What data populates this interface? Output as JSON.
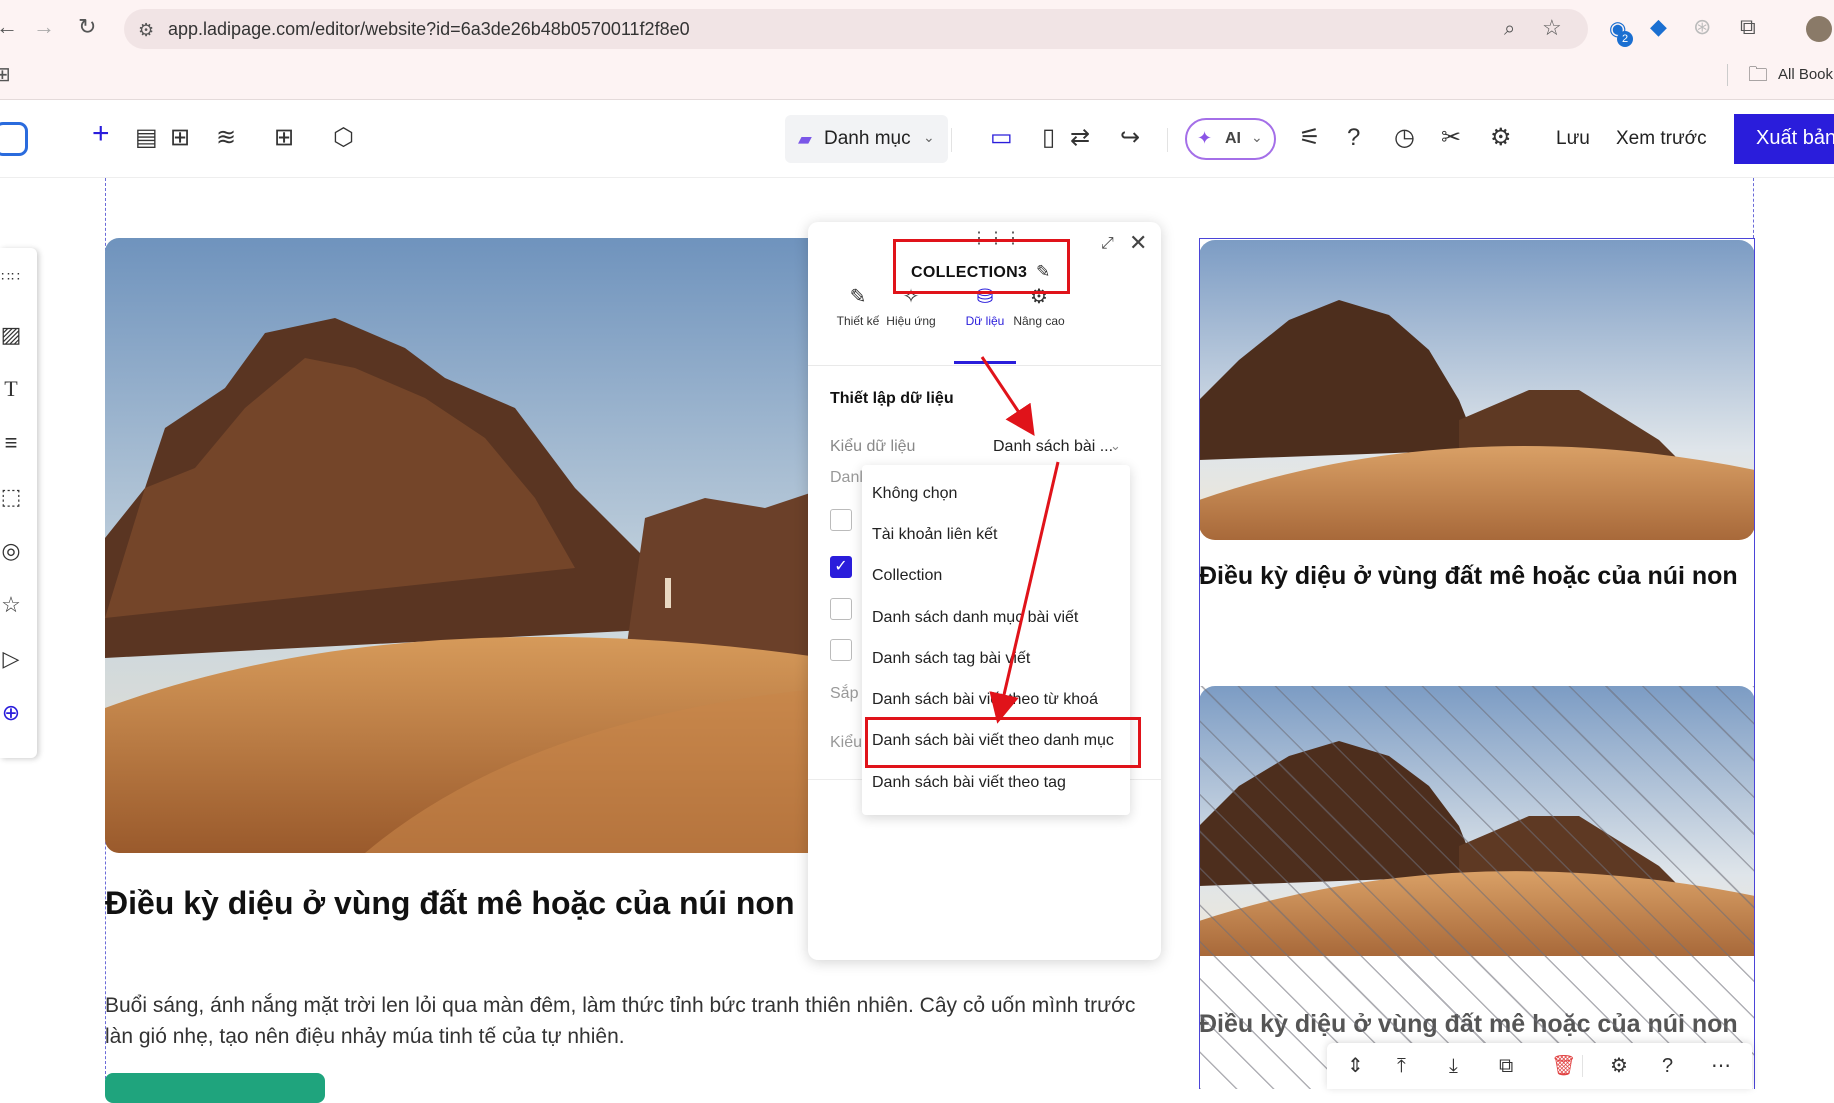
{
  "browser": {
    "url": "app.ladipage.com/editor/website?id=6a3de26b48b0570011f2f8e0",
    "bookmarks_label": "All Book",
    "ext_badge": "2"
  },
  "toolbar": {
    "category_label": "Danh mục",
    "ai_label": "AI",
    "save_label": "Lưu",
    "preview_label": "Xem trước",
    "publish_label": "Xuất bản"
  },
  "canvas": {
    "main_title": "Điều kỳ diệu ở vùng đất mê hoặc của núi non",
    "main_desc": "Buổi sáng, ánh nắng mặt trời len lỏi qua màn đêm, làm thức tỉnh bức tranh thiên nhiên. Cây cỏ uốn mình trước làn gió nhẹ, tạo nên điệu nhảy múa tinh tế của tự nhiên.",
    "card1_title": "Điều kỳ diệu ở vùng đất mê hoặc của núi non",
    "card2_title": "Điều kỳ diệu ở vùng đất mê hoặc của núi non"
  },
  "panel": {
    "title": "COLLECTION3",
    "tabs": [
      {
        "label": "Thiết kế",
        "icon": "edit-icon"
      },
      {
        "label": "Hiệu ứng",
        "icon": "magic-wand-icon"
      },
      {
        "label": "Dữ liệu",
        "icon": "database-icon"
      },
      {
        "label": "Nâng cao",
        "icon": "advanced-settings-icon"
      }
    ],
    "active_tab": "Dữ liệu",
    "section_title": "Thiết lập dữ liệu",
    "data_type_label": "Kiểu dữ liệu",
    "data_type_value": "Danh sách bài ...",
    "partial_labels": [
      "Danl",
      "Sắp",
      "Kiểu"
    ],
    "checkboxes": [
      false,
      true,
      false,
      false
    ]
  },
  "dropdown": {
    "options": [
      "Không chọn",
      "Tài khoản liên kết",
      "Collection",
      "Danh sách danh mục bài viết",
      "Danh sách tag bài viết",
      "Danh sách bài viết theo từ khoá",
      "Danh sách bài viết theo danh mục",
      "Danh sách bài viết theo tag"
    ],
    "highlighted": "Danh sách bài viết theo danh mục"
  },
  "colors": {
    "accent": "#2a1ddb",
    "annotation_red": "#e0131a",
    "button_green": "#1fa47d"
  }
}
